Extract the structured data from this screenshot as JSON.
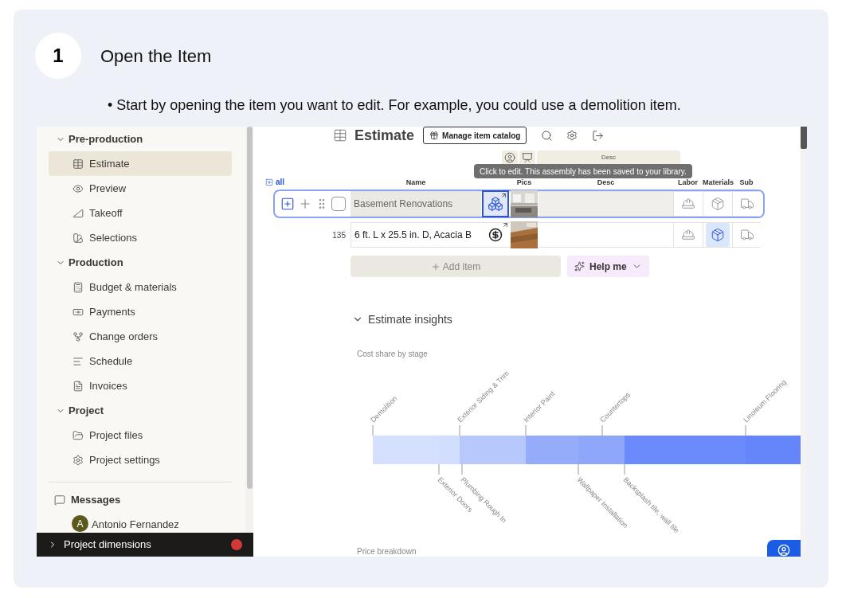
{
  "step": {
    "number": "1",
    "title": "Open the Item"
  },
  "instruction": "• Start by opening the item you want to edit. For example, you could use a demolition item.",
  "sidebar": {
    "groups": [
      {
        "label": "Pre-production",
        "expanded": true,
        "items": [
          {
            "label": "Estimate",
            "selected": true
          },
          {
            "label": "Preview",
            "selected": false
          },
          {
            "label": "Takeoff",
            "selected": false
          },
          {
            "label": "Selections",
            "selected": false
          }
        ]
      },
      {
        "label": "Production",
        "expanded": true,
        "items": [
          {
            "label": "Budget & materials",
            "selected": false
          },
          {
            "label": "Payments",
            "selected": false
          },
          {
            "label": "Change orders",
            "selected": false
          },
          {
            "label": "Schedule",
            "selected": false
          },
          {
            "label": "Invoices",
            "selected": false
          }
        ]
      },
      {
        "label": "Project",
        "expanded": true,
        "items": [
          {
            "label": "Project files",
            "selected": false
          },
          {
            "label": "Project settings",
            "selected": false
          }
        ]
      }
    ],
    "messages": {
      "label": "Messages",
      "contacts": [
        {
          "initial": "A",
          "name": "Antonio Fernandez"
        }
      ]
    },
    "footer": {
      "label": "Project dimensions",
      "alert": true
    }
  },
  "estimate": {
    "title": "Estimate",
    "catalog_button": "Manage item catalog",
    "group_header": "Desc",
    "expand_all": "all",
    "columns": [
      "Name",
      "Pics",
      "Desc",
      "Labor",
      "Materials",
      "Sub"
    ],
    "tooltip": "Click to edit. This assembly has been saved to your library.",
    "rows": [
      {
        "kind": "assembly",
        "name": "Basement Renovations",
        "selected": true,
        "checked": false,
        "materials_on": false
      },
      {
        "kind": "item",
        "number": "135",
        "name": "6 ft. L x 25.5 in. D, Acacia B",
        "selected": false,
        "materials_on": true
      }
    ],
    "add_button": "Add item",
    "help_button": "Help me"
  },
  "insights": {
    "title": "Estimate insights",
    "expanded": true,
    "cost_share": {
      "title": "Cost share by stage",
      "stages": [
        {
          "label": "Demolition",
          "kind": "top",
          "color": "#d4e0fd"
        },
        {
          "label": "Exterior Doors",
          "kind": "bottom",
          "color": "#d2defd"
        },
        {
          "label": "Exterior Siding & Trim",
          "kind": "top",
          "color": "#b7c8fc"
        },
        {
          "label": "Plumbing Rough In",
          "kind": "bottom",
          "color": "#b7c8fc"
        },
        {
          "label": "Interior Paint",
          "kind": "top",
          "color": "#95acfb"
        },
        {
          "label": "Wallpaper Installation",
          "kind": "bottom",
          "color": "#8fa7fa"
        },
        {
          "label": "Countertops",
          "kind": "top",
          "color": "#8fa7fa"
        },
        {
          "label": "Backsplash tile, wall tile",
          "kind": "bottom",
          "color": "#6b8bfc"
        },
        {
          "label": "Linoleum Flooring",
          "kind": "top",
          "color": "#6586fb"
        }
      ]
    },
    "price_breakdown": {
      "title": "Price breakdown"
    }
  }
}
